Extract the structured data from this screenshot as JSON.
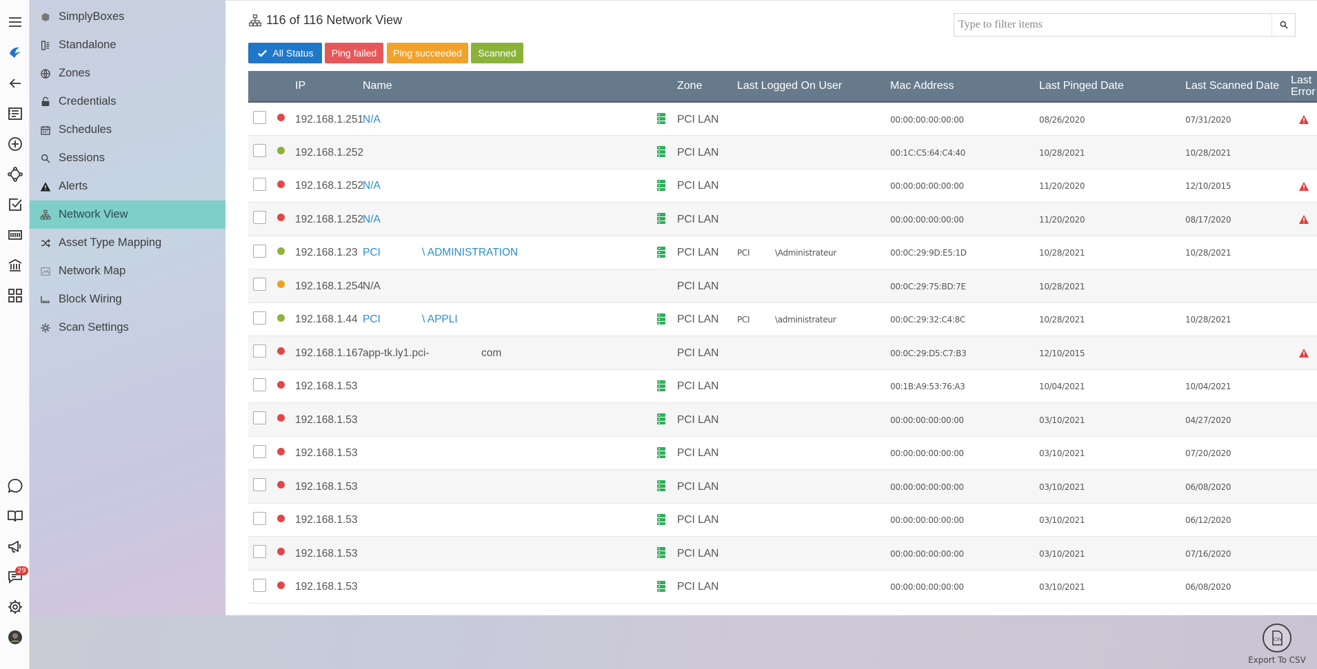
{
  "rail": {
    "notification_count": "29"
  },
  "sidebar": {
    "items": [
      {
        "label": "SimplyBoxes",
        "icon": "cube-icon"
      },
      {
        "label": "Standalone",
        "icon": "server-icon"
      },
      {
        "label": "Zones",
        "icon": "globe-icon"
      },
      {
        "label": "Credentials",
        "icon": "lock-icon"
      },
      {
        "label": "Schedules",
        "icon": "calendar-icon"
      },
      {
        "label": "Sessions",
        "icon": "search-icon"
      },
      {
        "label": "Alerts",
        "icon": "warning-icon"
      },
      {
        "label": "Network View",
        "icon": "network-icon",
        "active": true
      },
      {
        "label": "Asset Type Mapping",
        "icon": "shuffle-icon"
      },
      {
        "label": "Network Map",
        "icon": "map-icon"
      },
      {
        "label": "Block Wiring",
        "icon": "wiring-icon"
      },
      {
        "label": "Scan Settings",
        "icon": "gear-icon"
      }
    ]
  },
  "header": {
    "title": "116 of 116 Network View",
    "filter_placeholder": "Type to filter items"
  },
  "filters": {
    "all": "All Status",
    "failed": "Ping failed",
    "succeeded": "Ping succeeded",
    "scanned": "Scanned"
  },
  "colors": {
    "status_failed": "#e04747",
    "status_succeeded": "#8db33a",
    "status_pending": "#f0a21c",
    "accent": "#1f77c9",
    "zone_icon": "#2fae5a",
    "warning": "#e03b3b"
  },
  "table": {
    "columns": {
      "ip": "IP",
      "name": "Name",
      "zone": "Zone",
      "user": "Last Logged On User",
      "mac": "Mac Address",
      "pinged": "Last Pinged Date",
      "scanned": "Last Scanned Date",
      "error_1": "Last",
      "error_2": "Error"
    },
    "rows": [
      {
        "status": "failed",
        "ip": "192.168.1.251",
        "name": "N/A",
        "name2": "",
        "name_link": true,
        "zone_icon": true,
        "zone": "PCI LAN",
        "user": "",
        "user2": "",
        "mac": "00:00:00:00:00:00",
        "pinged": "08/26/2020",
        "scanned": "07/31/2020",
        "error": true
      },
      {
        "status": "succeeded",
        "ip": "192.168.1.252",
        "name": "",
        "name2": "",
        "name_link": false,
        "zone_icon": true,
        "zone": "PCI LAN",
        "user": "",
        "user2": "",
        "mac": "00:1C:C5:64:C4:40",
        "pinged": "10/28/2021",
        "scanned": "10/28/2021",
        "error": false
      },
      {
        "status": "failed",
        "ip": "192.168.1.252",
        "name": "N/A",
        "name2": "",
        "name_link": true,
        "zone_icon": true,
        "zone": "PCI LAN",
        "user": "",
        "user2": "",
        "mac": "00:00:00:00:00:00",
        "pinged": "11/20/2020",
        "scanned": "12/10/2015",
        "error": true
      },
      {
        "status": "failed",
        "ip": "192.168.1.252",
        "name": "N/A",
        "name2": "",
        "name_link": true,
        "zone_icon": true,
        "zone": "PCI LAN",
        "user": "",
        "user2": "",
        "mac": "00:00:00:00:00:00",
        "pinged": "11/20/2020",
        "scanned": "08/17/2020",
        "error": true
      },
      {
        "status": "succeeded",
        "ip": "192.168.1.23",
        "name": "PCI",
        "name2": "\\ ADMINISTRATION",
        "name_link": true,
        "zone_icon": true,
        "zone": "PCI LAN",
        "user": "PCI",
        "user2": "\\Administrateur",
        "mac": "00:0C:29:9D:E5:1D",
        "pinged": "10/28/2021",
        "scanned": "10/28/2021",
        "error": false
      },
      {
        "status": "pending",
        "ip": "192.168.1.254",
        "name": "N/A",
        "name2": "",
        "name_link": false,
        "zone_icon": false,
        "zone": "PCI LAN",
        "user": "",
        "user2": "",
        "mac": "00:0C:29:75:BD:7E",
        "pinged": "10/28/2021",
        "scanned": "",
        "error": false
      },
      {
        "status": "succeeded",
        "ip": "192.168.1.44",
        "name": "PCI",
        "name2": "\\ APPLI",
        "name_link": true,
        "zone_icon": true,
        "zone": "PCI LAN",
        "user": "PCI",
        "user2": "\\administrateur",
        "mac": "00:0C:29:32:C4:8C",
        "pinged": "10/28/2021",
        "scanned": "10/28/2021",
        "error": false
      },
      {
        "status": "failed",
        "ip": "192.168.1.167",
        "name": "app-tk.ly1.pci-",
        "name2": "com",
        "name_link": false,
        "zone_icon": false,
        "zone": "PCI LAN",
        "user": "",
        "user2": "",
        "mac": "00:0C:29:D5:C7:B3",
        "pinged": "12/10/2015",
        "scanned": "",
        "error": true
      },
      {
        "status": "failed",
        "ip": "192.168.1.53",
        "name": "",
        "name2": "",
        "name_link": false,
        "zone_icon": true,
        "zone": "PCI LAN",
        "user": "",
        "user2": "",
        "mac": "00:1B:A9:53:76:A3",
        "pinged": "10/04/2021",
        "scanned": "10/04/2021",
        "error": false
      },
      {
        "status": "failed",
        "ip": "192.168.1.53",
        "name": "",
        "name2": "",
        "name_link": false,
        "zone_icon": true,
        "zone": "PCI LAN",
        "user": "",
        "user2": "",
        "mac": "00:00:00:00:00:00",
        "pinged": "03/10/2021",
        "scanned": "04/27/2020",
        "error": false
      },
      {
        "status": "failed",
        "ip": "192.168.1.53",
        "name": "",
        "name2": "",
        "name_link": false,
        "zone_icon": true,
        "zone": "PCI LAN",
        "user": "",
        "user2": "",
        "mac": "00:00:00:00:00:00",
        "pinged": "03/10/2021",
        "scanned": "07/20/2020",
        "error": false
      },
      {
        "status": "failed",
        "ip": "192.168.1.53",
        "name": "",
        "name2": "",
        "name_link": false,
        "zone_icon": true,
        "zone": "PCI LAN",
        "user": "",
        "user2": "",
        "mac": "00:00:00:00:00:00",
        "pinged": "03/10/2021",
        "scanned": "06/08/2020",
        "error": false
      },
      {
        "status": "failed",
        "ip": "192.168.1.53",
        "name": "",
        "name2": "",
        "name_link": false,
        "zone_icon": true,
        "zone": "PCI LAN",
        "user": "",
        "user2": "",
        "mac": "00:00:00:00:00:00",
        "pinged": "03/10/2021",
        "scanned": "06/12/2020",
        "error": false
      },
      {
        "status": "failed",
        "ip": "192.168.1.53",
        "name": "",
        "name2": "",
        "name_link": false,
        "zone_icon": true,
        "zone": "PCI LAN",
        "user": "",
        "user2": "",
        "mac": "00:00:00:00:00:00",
        "pinged": "03/10/2021",
        "scanned": "07/16/2020",
        "error": false
      },
      {
        "status": "failed",
        "ip": "192.168.1.53",
        "name": "",
        "name2": "",
        "name_link": false,
        "zone_icon": true,
        "zone": "PCI LAN",
        "user": "",
        "user2": "",
        "mac": "00:00:00:00:00:00",
        "pinged": "03/10/2021",
        "scanned": "06/08/2020",
        "error": false
      }
    ]
  },
  "footer": {
    "export_label": "Export To CSV",
    "csv_glyph": "CSV"
  }
}
